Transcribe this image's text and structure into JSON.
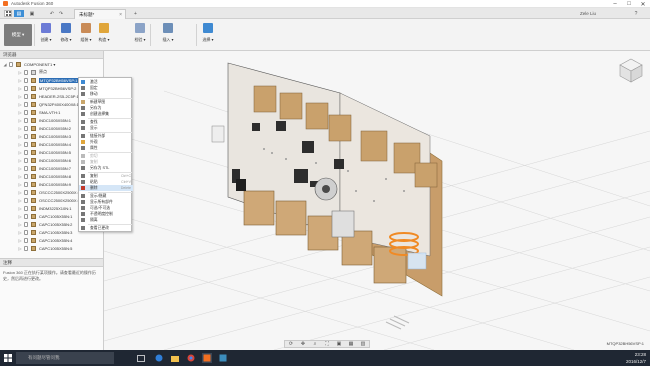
{
  "window": {
    "title": "Autodesk Fusion 360"
  },
  "toolbar": {
    "doc_tab_label": "未标题*",
    "user_name": "Zele Liu"
  },
  "ribbon": {
    "workspace_label": "模型 ▾",
    "tools": [
      {
        "label": "创建 ▾",
        "color": "#6c7bd6",
        "icon": "create-icon"
      },
      {
        "label": "修改 ▾",
        "color": "#4a78c5",
        "icon": "modify-icon"
      },
      {
        "label": "组装 ▾",
        "color": "#c98b57",
        "icon": "assemble-icon"
      },
      {
        "label": "构造 ▾",
        "color": "#e0a63b",
        "icon": "construct-icon"
      },
      {
        "label": "检验 ▾",
        "color": "#8ba3c7",
        "icon": "inspect-icon"
      },
      {
        "label": "插入 ▾",
        "color": "#6d8fb8",
        "icon": "insert-icon"
      },
      {
        "label": "选择 ▾",
        "color": "#3f8ad2",
        "icon": "select-icon"
      }
    ]
  },
  "browser": {
    "header": "浏览器",
    "root_label": "COMPONENT1 ▾",
    "items": [
      "原点",
      "MTQP32BH56VSP:1",
      "MTQP32BH56VSP:2",
      "HEADER-2S5-2C5P:1",
      "QFN32P400X400X8:1",
      "SMA-VTH:1",
      "INDC1005X55N:1",
      "INDC1005X55N:2",
      "INDC1005X55N:3",
      "INDC1005X55N:4",
      "INDC1005X55N:5",
      "INDC1005X55N:6",
      "INDC1005X55N:7",
      "INDC1005X55N:8",
      "INDC1005X55N:9",
      "OSCCC2500X2500X:1",
      "OSCCC2500X2500X:2",
      "INDM3225X10N:1",
      "CAPC1005X55N:1",
      "CAPC1005X55N:2",
      "CAPC1005X55N:3",
      "CAPC1005X55N:4",
      "CAPC1005X55N:5"
    ]
  },
  "context_menu": {
    "items": [
      {
        "label": "激活",
        "shortcut": "",
        "state": "normal",
        "icon_color": "#3f8ad2"
      },
      {
        "label": "固定",
        "shortcut": "",
        "state": "normal",
        "icon_color": "#777"
      },
      {
        "label": "移动",
        "shortcut": "",
        "state": "normal",
        "icon_color": "#777"
      },
      {
        "sep": true
      },
      {
        "label": "新建草图",
        "shortcut": "",
        "state": "normal",
        "icon_color": "#c9a66b"
      },
      {
        "label": "另存为",
        "shortcut": "",
        "state": "normal",
        "icon_color": "#777"
      },
      {
        "label": "创建选择集",
        "shortcut": "",
        "state": "normal",
        "icon_color": "#777"
      },
      {
        "sep": true
      },
      {
        "label": "查找",
        "shortcut": "",
        "state": "normal",
        "icon_color": "#777"
      },
      {
        "label": "显示",
        "shortcut": "",
        "state": "normal",
        "icon_color": "#777"
      },
      {
        "sep": true
      },
      {
        "label": "链接外部",
        "shortcut": "",
        "state": "normal",
        "icon_color": "#777"
      },
      {
        "label": "外观",
        "shortcut": "",
        "state": "normal",
        "icon_color": "#e0a63b"
      },
      {
        "label": "属性",
        "shortcut": "",
        "state": "normal",
        "icon_color": "#777"
      },
      {
        "sep": true
      },
      {
        "label": "剪切",
        "shortcut": "",
        "state": "disabled",
        "icon_color": "#bbb"
      },
      {
        "label": "复制",
        "shortcut": "",
        "state": "disabled",
        "icon_color": "#bbb"
      },
      {
        "label": "另存为 STL",
        "shortcut": "",
        "state": "normal",
        "icon_color": "#777"
      },
      {
        "sep": true
      },
      {
        "label": "复制",
        "shortcut": "Ctrl+C",
        "state": "normal",
        "icon_color": "#777"
      },
      {
        "label": "粘贴",
        "shortcut": "Ctrl+V",
        "state": "normal",
        "icon_color": "#777"
      },
      {
        "label": "删除",
        "shortcut": "Delete",
        "state": "highlight",
        "icon_color": "#c0392b"
      },
      {
        "sep": true
      },
      {
        "label": "显示/隐藏",
        "shortcut": "",
        "state": "normal",
        "icon_color": "#777"
      },
      {
        "label": "显示所有部件",
        "shortcut": "",
        "state": "normal",
        "icon_color": "#777"
      },
      {
        "label": "可选/不可选",
        "shortcut": "",
        "state": "normal",
        "icon_color": "#777"
      },
      {
        "label": "不透明度控制",
        "shortcut": "",
        "state": "normal",
        "icon_color": "#777"
      },
      {
        "label": "隔离",
        "shortcut": "",
        "state": "normal",
        "icon_color": "#777"
      },
      {
        "sep": true
      },
      {
        "label": "查看已更改",
        "shortcut": "",
        "state": "normal",
        "icon_color": "#777"
      }
    ]
  },
  "comments": {
    "header": "注释",
    "body": "Fusion 360 正在执行某项操作。请查看最近的操作历史，然后再进行更改。"
  },
  "canvas": {
    "status_text": "MTQP32BH56VSP:1",
    "viewcube_label": "前"
  },
  "taskbar": {
    "search_placeholder": "有问题尽管问我",
    "time": "23:28",
    "date": "2016/12/7"
  }
}
